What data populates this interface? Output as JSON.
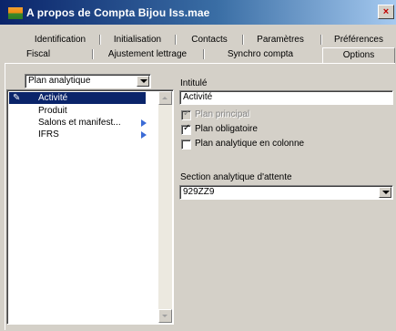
{
  "window": {
    "title": "A propos de Compta Bijou Iss.mae",
    "close_glyph": "×"
  },
  "tabs": {
    "row1": [
      "Identification",
      "Initialisation",
      "Contacts",
      "Paramètres",
      "Préférences"
    ],
    "row2": [
      "Fiscal",
      "Ajustement lettrage",
      "Synchro compta",
      "Options"
    ],
    "active": "Options"
  },
  "left": {
    "selector": {
      "value": "Plan analytique"
    },
    "items": [
      {
        "label": "Activité",
        "selected": true,
        "icon": "pencil-icon"
      },
      {
        "label": "Produit",
        "selected": false
      },
      {
        "label": "Salons et manifest...",
        "selected": false,
        "has_children": true
      },
      {
        "label": "IFRS",
        "selected": false,
        "has_children": true
      }
    ]
  },
  "right": {
    "intitule_label": "Intitulé",
    "intitule_value": "Activité",
    "checkboxes": [
      {
        "label": "Plan principal",
        "checked": true,
        "disabled": true
      },
      {
        "label": "Plan obligatoire",
        "checked": true,
        "disabled": false
      },
      {
        "label": "Plan analytique en colonne",
        "checked": false,
        "disabled": false
      }
    ],
    "section_label": "Section analytique d'attente",
    "section_value": "929ZZ9"
  },
  "colors": {
    "titlebar_start": "#0a246a",
    "titlebar_end": "#a6caf0",
    "selection": "#0a246a",
    "face": "#d4d0c8"
  }
}
